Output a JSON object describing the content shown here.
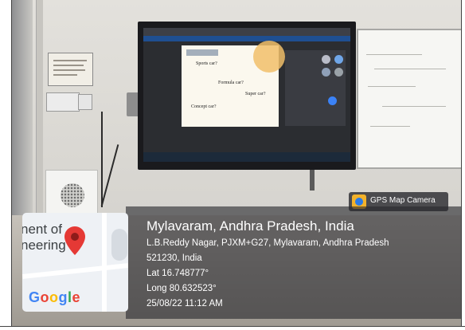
{
  "badge": {
    "label": "GPS Map Camera",
    "icon": "gps-map-camera-icon"
  },
  "map": {
    "text_lines": [
      "nent of",
      "neering"
    ],
    "logo": "Google",
    "logo_colors": [
      "#4285F4",
      "#EA4335",
      "#FBBC05",
      "#4285F4",
      "#34A853",
      "#EA4335"
    ],
    "pin_color": "#E53935",
    "pin_icon": "map-pin-icon"
  },
  "location": {
    "title": "Mylavaram, Andhra Pradesh, India",
    "address_line1": "L.B.Reddy Nagar, PJXM+G27, Mylavaram, Andhra Pradesh",
    "address_line2": "521230, India",
    "lat": "Lat 16.748777°",
    "long": "Long 80.632523°",
    "datetime": "25/08/22 11:12 AM"
  },
  "screen_slide": {
    "lines": [
      "Sports car?",
      "Formula car?",
      "Super car?",
      "Concept car?"
    ]
  }
}
